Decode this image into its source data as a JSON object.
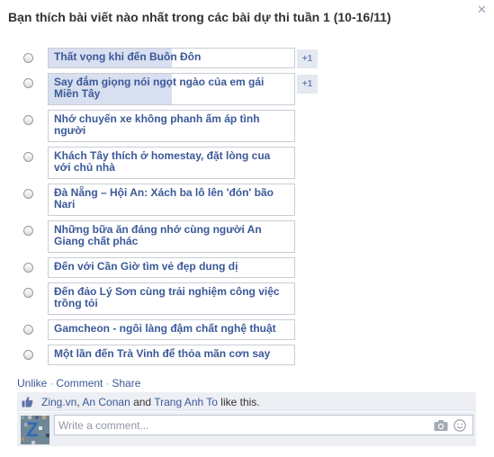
{
  "poll": {
    "title": "Bạn thích bài viết nào nhất trong các bài dự thi tuần 1 (10-16/11)",
    "close_icon": "close-icon",
    "options": [
      {
        "label": "Thất vọng khi đến Buôn Đôn",
        "votes": "+1",
        "fill_pct": 50
      },
      {
        "label": "Say đắm giọng nói ngọt ngào của em gái Miền Tây",
        "votes": "+1",
        "fill_pct": 50
      },
      {
        "label": "Nhớ chuyến xe không phanh ấm áp tình người",
        "votes": "",
        "fill_pct": 0
      },
      {
        "label": "Khách Tây thích ở homestay, đặt lòng cua với chủ nhà",
        "votes": "",
        "fill_pct": 0
      },
      {
        "label": "Đà Nẵng – Hội An: Xách ba lô lên 'đón' bão Nari",
        "votes": "",
        "fill_pct": 0
      },
      {
        "label": "Những bữa ăn đáng nhớ cùng người An Giang chất phác",
        "votes": "",
        "fill_pct": 0
      },
      {
        "label": "Đến với Cần Giờ tìm vẻ đẹp dung dị",
        "votes": "",
        "fill_pct": 0
      },
      {
        "label": "Đến đảo Lý Sơn cùng trải nghiệm công việc trồng tỏi",
        "votes": "",
        "fill_pct": 0
      },
      {
        "label": "Gamcheon - ngôi làng đậm chất nghệ thuật",
        "votes": "",
        "fill_pct": 0
      },
      {
        "label": "Một lần đến Trà Vinh để thỏa mãn cơn say",
        "votes": "",
        "fill_pct": 0
      }
    ]
  },
  "actions": {
    "unlike": "Unlike",
    "comment": "Comment",
    "share": "Share",
    "separator": "·"
  },
  "likes": {
    "icon": "thumbs-up-icon",
    "user1": "Zing.vn",
    "sep1": ", ",
    "user2": "An Conan",
    "and": " and ",
    "user3": "Trang Anh To",
    "suffix": " like this."
  },
  "comment_box": {
    "avatar_letter": "Z",
    "placeholder": "Write a comment..."
  },
  "colors": {
    "link": "#3b5998",
    "bar_fill": "#d8dff0",
    "footer_bg": "#edeff4"
  }
}
